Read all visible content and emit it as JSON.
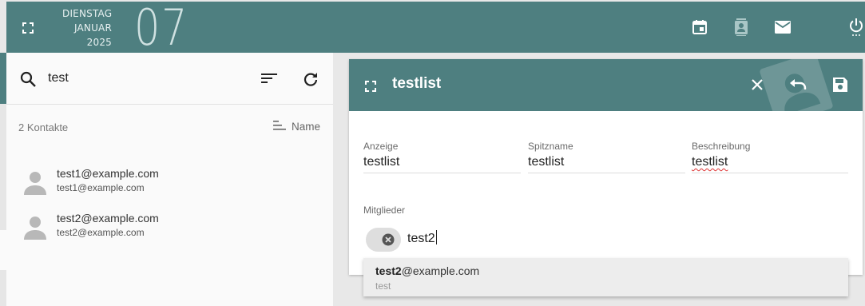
{
  "header": {
    "weekday": "DIENSTAG",
    "month": "JANUAR",
    "year": "2025",
    "day": "07",
    "icons": [
      "calendar-icon",
      "contacts-icon",
      "mail-icon",
      "power-icon"
    ],
    "accent_color": "#4e7f80"
  },
  "search": {
    "value": "test"
  },
  "contacts": {
    "count_label": "2 Kontakte",
    "sort_label": "Name",
    "items": [
      {
        "name": "test1@example.com",
        "email": "test1@example.com"
      },
      {
        "name": "test2@example.com",
        "email": "test2@example.com"
      }
    ]
  },
  "editor": {
    "title": "testlist",
    "fields": {
      "display": {
        "label": "Anzeige",
        "value": "testlist"
      },
      "nickname": {
        "label": "Spitzname",
        "value": "testlist"
      },
      "description": {
        "label": "Beschreibung",
        "value": "testlist"
      }
    },
    "members_label": "Mitglieder",
    "member_input": "test2"
  },
  "suggestion": {
    "match": "test2",
    "rest": "@example.com",
    "sub": "test"
  }
}
